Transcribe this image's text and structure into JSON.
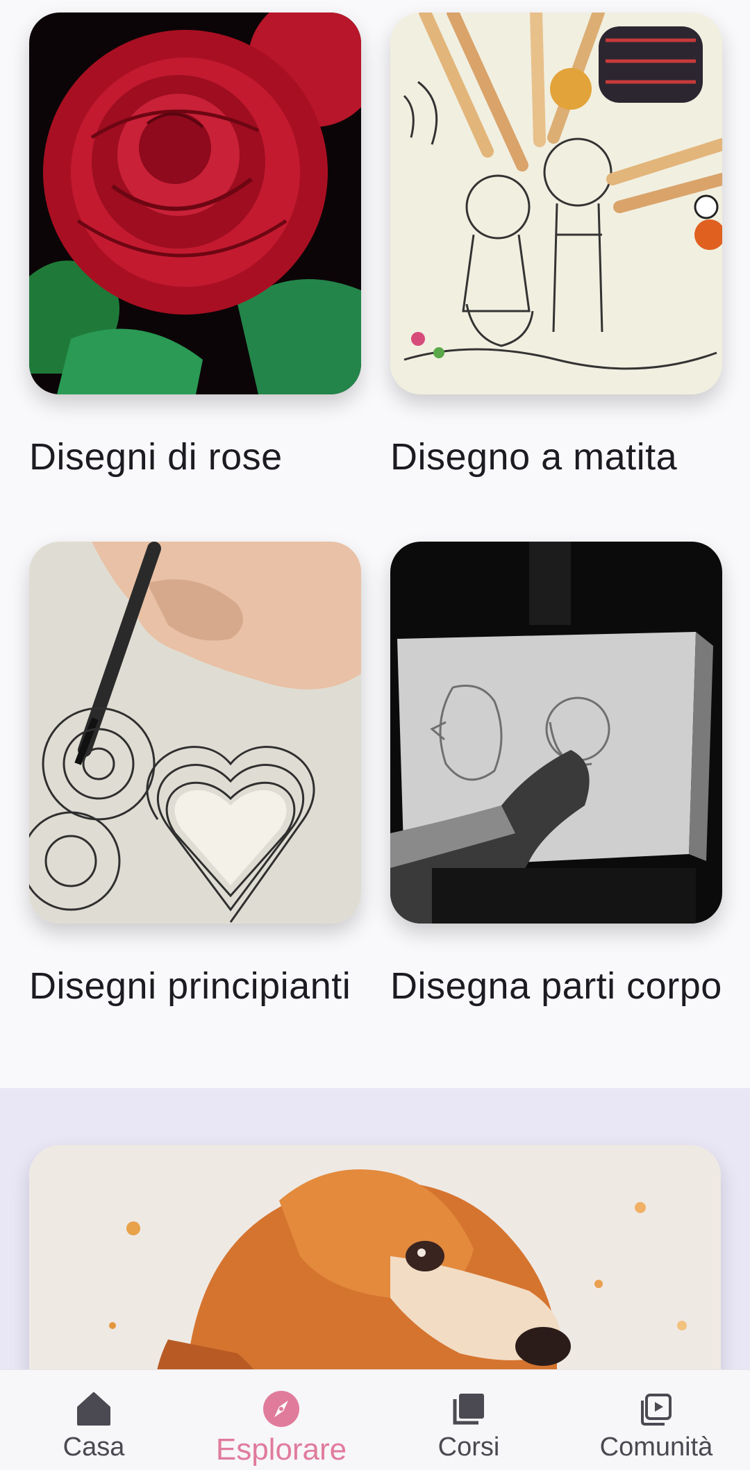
{
  "cards": [
    {
      "title": "Disegni di rose",
      "image": "red-rose-drawing"
    },
    {
      "title": "Disegno a matita",
      "image": "children-pencil-coloring"
    },
    {
      "title": "Disegni principianti",
      "image": "mandala-heart-pen"
    },
    {
      "title": "Disegna parti corpo",
      "image": "easel-face-sketch"
    }
  ],
  "featured": {
    "image": "watercolor-dog"
  },
  "nav": {
    "items": [
      {
        "label": "Casa",
        "icon": "home-icon"
      },
      {
        "label": "Esplorare",
        "icon": "compass-icon",
        "active": true
      },
      {
        "label": "Corsi",
        "icon": "book-stack-icon"
      },
      {
        "label": "Comunità",
        "icon": "video-library-icon"
      }
    ]
  },
  "colors": {
    "accent": "#e07b9c",
    "featured_bg": "#e9e6f6",
    "text": "#1c1b22"
  }
}
